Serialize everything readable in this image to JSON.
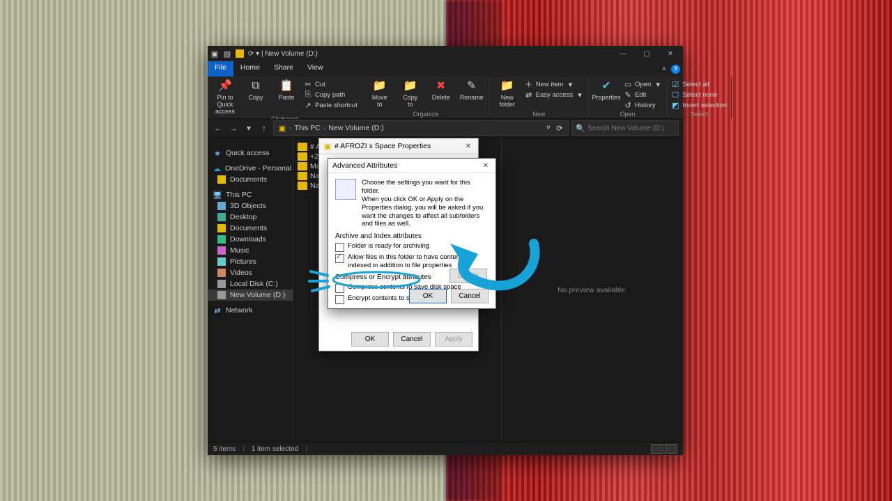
{
  "title": "New Volume (D:)",
  "titlebar_hint": "⟳ ▾ | New Volume (D:)",
  "tabs": {
    "file": "File",
    "home": "Home",
    "share": "Share",
    "view": "View"
  },
  "ribbon": {
    "clipboard": {
      "label": "Clipboard",
      "pin": "Pin to Quick\naccess",
      "copy": "Copy",
      "paste": "Paste",
      "cut": "Cut",
      "copypath": "Copy path",
      "pasteshort": "Paste shortcut"
    },
    "organize": {
      "label": "Organize",
      "move": "Move\nto",
      "copyto": "Copy\nto",
      "delete": "Delete",
      "rename": "Rename"
    },
    "newgrp": {
      "label": "New",
      "newfolder": "New\nfolder",
      "newitem": "New item",
      "easyaccess": "Easy access"
    },
    "open": {
      "label": "Open",
      "properties": "Properties",
      "openbtn": "Open",
      "edit": "Edit",
      "history": "History"
    },
    "select": {
      "label": "Select",
      "selectall": "Select all",
      "selectnone": "Select none",
      "invert": "Invert selection"
    }
  },
  "breadcrumbs": {
    "root": "This PC",
    "vol": "New Volume (D:)"
  },
  "search_placeholder": "Search New Volume (D:)",
  "sidebar": {
    "quick": "Quick access",
    "onedrive": "OneDrive - Personal",
    "documents": "Documents",
    "thispc": "This PC",
    "items": [
      "3D Objects",
      "Desktop",
      "Documents",
      "Downloads",
      "Music",
      "Pictures",
      "Videos",
      "Local Disk (C:)",
      "New Volume (D:)"
    ],
    "network": "Network"
  },
  "files": [
    "# AFROZI x …",
    "+2023 3D-P…",
    "MasterSoft…",
    "Nawa Work…",
    "Nawa Work…"
  ],
  "preview_msg": "No preview available.",
  "status": {
    "items": "5 items",
    "selected": "1 item selected"
  },
  "props": {
    "title": "# AFROZI x Space Properties",
    "ok": "OK",
    "cancel": "Cancel",
    "apply": "Apply"
  },
  "adv": {
    "title": "Advanced Attributes",
    "intro1": "Choose the settings you want for this folder.",
    "intro2": "When you click OK or Apply on the Properties dialog, you will be asked if you want the changes to affect all subfolders and files as well.",
    "section1": "Archive and Index attributes",
    "chk_archive": "Folder is ready for archiving",
    "chk_index": "Allow files in this folder to have contents indexed in addition to file properties",
    "section2": "Compress or Encrypt attributes",
    "chk_compress": "Compress contents to save disk space",
    "chk_encrypt": "Encrypt contents to secure data",
    "details": "Details",
    "ok": "OK",
    "cancel": "Cancel"
  }
}
